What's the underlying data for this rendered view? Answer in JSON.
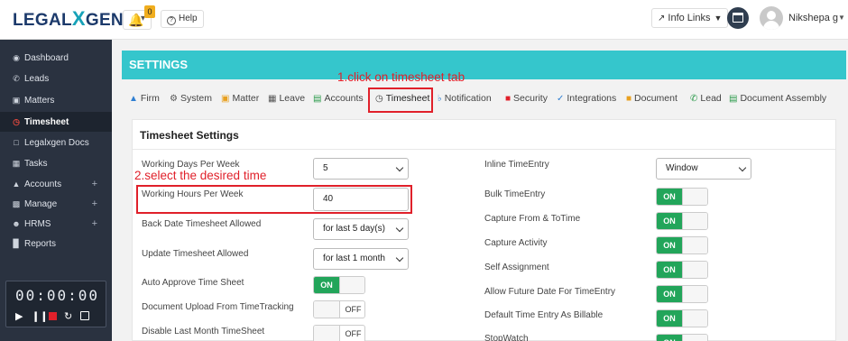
{
  "brand": {
    "logo_left": "LEGAL",
    "logo_x": "X",
    "logo_right": "GEN"
  },
  "topbar": {
    "notification_count": "0",
    "help_label": "Help",
    "info_links_label": "Info Links",
    "user_name": "Nikshepa g"
  },
  "sidebar": {
    "items": [
      {
        "label": "Dashboard",
        "icon": "dashboard-icon"
      },
      {
        "label": "Leads",
        "icon": "phone-icon"
      },
      {
        "label": "Matters",
        "icon": "briefcase-icon"
      },
      {
        "label": "Timesheet",
        "icon": "clock-icon"
      },
      {
        "label": "Legalxgen Docs",
        "icon": "folder-icon"
      },
      {
        "label": "Tasks",
        "icon": "calendar-icon"
      },
      {
        "label": "Accounts",
        "icon": "bank-icon"
      },
      {
        "label": "Manage",
        "icon": "building-icon"
      },
      {
        "label": "HRMS",
        "icon": "users-icon"
      },
      {
        "label": "Reports",
        "icon": "bar-chart-icon"
      }
    ],
    "timer": "00:00:00"
  },
  "settings_title": "SETTINGS",
  "tabs": [
    {
      "label": "Firm"
    },
    {
      "label": "System"
    },
    {
      "label": "Matter"
    },
    {
      "label": "Leave"
    },
    {
      "label": "Accounts"
    },
    {
      "label": "Timesheet"
    },
    {
      "label": "Notification"
    },
    {
      "label": "Security"
    },
    {
      "label": "Integrations"
    },
    {
      "label": "Document"
    },
    {
      "label": "Lead"
    },
    {
      "label": "Document Assembly"
    }
  ],
  "annotations": {
    "step1": "1.click on timesheet tab",
    "step2": "2.select the desired time"
  },
  "panel": {
    "title": "Timesheet Settings",
    "left": {
      "working_days_label": "Working Days Per Week",
      "working_days_value": "5",
      "working_hours_label": "Working Hours Per Week",
      "working_hours_value": "40",
      "back_date_label": "Back Date Timesheet Allowed",
      "back_date_value": "for last 5 day(s)",
      "update_label": "Update Timesheet Allowed",
      "update_value": "for last 1 month",
      "auto_approve_label": "Auto Approve Time Sheet",
      "auto_approve_state": "ON",
      "doc_upload_label": "Document Upload From TimeTracking",
      "doc_upload_state": "OFF",
      "disable_last_month_label": "Disable Last Month TimeSheet",
      "disable_last_month_state": "OFF"
    },
    "right": {
      "inline_label": "Inline TimeEntry",
      "inline_value": "Window",
      "bulk_label": "Bulk TimeEntry",
      "bulk_state": "ON",
      "capture_from_label": "Capture From & ToTime",
      "capture_from_state": "ON",
      "capture_activity_label": "Capture Activity",
      "capture_activity_state": "ON",
      "self_assign_label": "Self Assignment",
      "self_assign_state": "ON",
      "future_date_label": "Allow Future Date For TimeEntry",
      "future_date_state": "ON",
      "default_billable_label": "Default Time Entry As Billable",
      "default_billable_state": "ON",
      "stopwatch_label": "StopWatch",
      "stopwatch_state": "ON"
    }
  },
  "colors": {
    "accent_teal": "#35c6cc",
    "sidebar_bg": "#2a3240",
    "toggle_on": "#22a55a",
    "annotation_red": "#e0202a"
  }
}
